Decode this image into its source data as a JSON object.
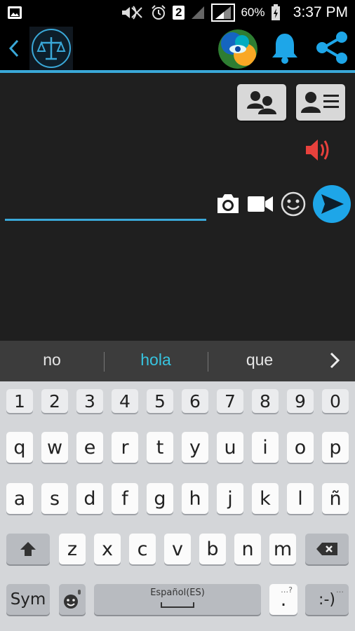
{
  "status_bar": {
    "sim_label": "2",
    "battery_percent": "60%",
    "time": "3:37 PM"
  },
  "app_bar": {
    "logo_icon": "scales-of-justice-icon",
    "actions": [
      "avatar",
      "bell-icon",
      "share-icon"
    ]
  },
  "chat": {
    "buttons": [
      "group-contacts-icon",
      "contact-card-icon"
    ],
    "message_input": {
      "value": "",
      "placeholder": ""
    },
    "colors": {
      "accent": "#3aa8d8",
      "speaker": "#e8413c"
    }
  },
  "keyboard": {
    "suggestions": [
      "no",
      "hola",
      "que"
    ],
    "highlighted_suggestion": "hola",
    "row_numbers": [
      "1",
      "2",
      "3",
      "4",
      "5",
      "6",
      "7",
      "8",
      "9",
      "0"
    ],
    "row1": [
      "q",
      "w",
      "e",
      "r",
      "t",
      "y",
      "u",
      "i",
      "o",
      "p"
    ],
    "row2": [
      "a",
      "s",
      "d",
      "f",
      "g",
      "h",
      "j",
      "k",
      "l",
      "ñ"
    ],
    "row3": [
      "z",
      "x",
      "c",
      "v",
      "b",
      "n",
      "m"
    ],
    "sym_label": "Sym",
    "space_label": "Español(ES)",
    "period_label": ".",
    "period_hint": "…?",
    "emoticon_label": ":-)",
    "emoticon_hint": "…"
  }
}
